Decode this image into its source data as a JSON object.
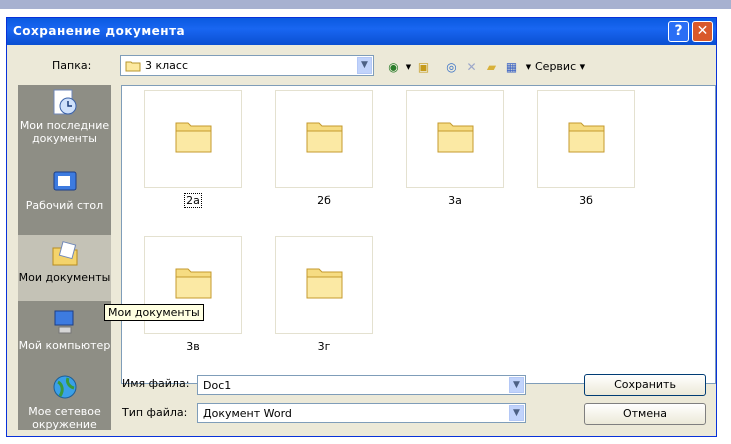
{
  "dialog": {
    "title": "Сохранение документа"
  },
  "folder_bar": {
    "label": "Папка:",
    "current": "3 класс",
    "service_label": "Сервис"
  },
  "places": [
    {
      "label": "Мои последние документы",
      "icon": "recent-documents-icon"
    },
    {
      "label": "Рабочий стол",
      "icon": "desktop-icon"
    },
    {
      "label": "Мои документы",
      "icon": "my-documents-icon",
      "selected": true
    },
    {
      "label": "Мой компьютер",
      "icon": "my-computer-icon"
    },
    {
      "label": "Мое сетевое окружение",
      "icon": "network-icon"
    }
  ],
  "files": [
    {
      "name": "2а",
      "selected": true
    },
    {
      "name": "2б"
    },
    {
      "name": "3а"
    },
    {
      "name": "3б"
    },
    {
      "name": "3в"
    },
    {
      "name": "3г"
    }
  ],
  "tooltip": "Мои документы",
  "filename": {
    "label": "Имя файла:",
    "value": "Doc1"
  },
  "filetype": {
    "label": "Тип файла:",
    "value": "Документ Word"
  },
  "buttons": {
    "save": "Сохранить",
    "cancel": "Отмена"
  },
  "colors": {
    "titlebar": "#0a5ae0",
    "dialog_bg": "#ece9d8",
    "places_bg": "#8e8e85"
  }
}
